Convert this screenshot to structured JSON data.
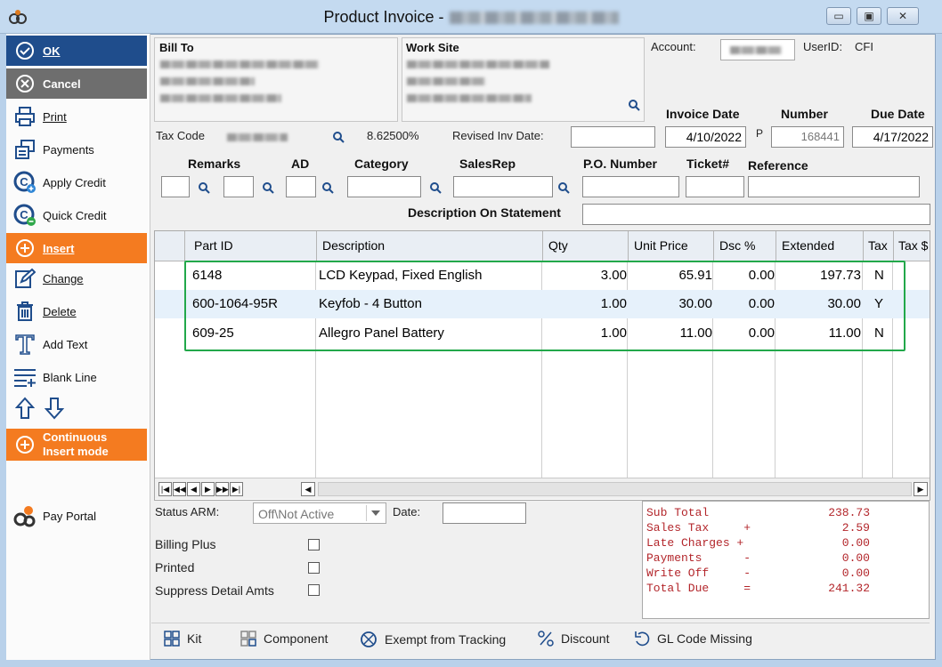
{
  "window": {
    "title": "Product Invoice -",
    "minimize_glyph": "▭",
    "maximize_glyph": "▣",
    "close_glyph": "✕"
  },
  "sidebar": {
    "ok": "OK",
    "cancel": "Cancel",
    "print": "Print",
    "payments": "Payments",
    "apply_credit": "Apply Credit",
    "quick_credit": "Quick Credit",
    "insert": "Insert",
    "change": "Change",
    "delete": "Delete",
    "add_text": "Add Text",
    "blank_line": "Blank Line",
    "continuous_line1": "Continuous",
    "continuous_line2": "Insert mode",
    "pay_portal": "Pay Portal"
  },
  "header": {
    "bill_to_label": "Bill To",
    "work_site_label": "Work Site",
    "account_label": "Account:",
    "user_id_label": "UserID:",
    "user_id_value": "CFI",
    "tax_code_label": "Tax Code",
    "tax_rate": "8.62500%",
    "revised_inv_date_label": "Revised Inv Date:",
    "invoice_date_label": "Invoice Date",
    "invoice_date_value": "4/10/2022",
    "number_label": "Number",
    "number_prefix": "P",
    "number_value": "168441",
    "due_date_label": "Due Date",
    "due_date_value": "4/17/2022",
    "remarks_label": "Remarks",
    "ad_label": "AD",
    "category_label": "Category",
    "salesrep_label": "SalesRep",
    "po_number_label": "P.O. Number",
    "ticket_label": "Ticket#",
    "reference_label": "Reference",
    "desc_on_statement_label": "Description On Statement"
  },
  "grid": {
    "columns": [
      "Part ID",
      "Description",
      "Qty",
      "Unit Price",
      "Dsc %",
      "Extended",
      "Tax",
      "Tax $"
    ],
    "rows": [
      {
        "part_id": "6148",
        "description": "LCD Keypad, Fixed English",
        "qty": "3.00",
        "unit_price": "65.91",
        "dsc": "0.00",
        "extended": "197.73",
        "tax": "N"
      },
      {
        "part_id": "600-1064-95R",
        "description": "Keyfob - 4 Button",
        "qty": "1.00",
        "unit_price": "30.00",
        "dsc": "0.00",
        "extended": "30.00",
        "tax": "Y"
      },
      {
        "part_id": "609-25",
        "description": "Allegro Panel Battery",
        "qty": "1.00",
        "unit_price": "11.00",
        "dsc": "0.00",
        "extended": "11.00",
        "tax": "N"
      }
    ],
    "nav": {
      "first": "|◀",
      "prev_page": "◀◀",
      "prev": "◀",
      "next": "▶",
      "next_page": "▶▶",
      "last": "▶|",
      "scroll_left": "◀",
      "scroll_right": "▶"
    }
  },
  "footer": {
    "status_arm_label": "Status ARM:",
    "status_arm_value": "Off\\Not Active",
    "date_label": "Date:",
    "billing_plus_label": "Billing Plus",
    "printed_label": "Printed",
    "suppress_detail_label": "Suppress Detail Amts"
  },
  "totals": {
    "lines": [
      {
        "label": "Sub Total      ",
        "value": "238.73"
      },
      {
        "label": "Sales Tax     +",
        "value": "2.59"
      },
      {
        "label": "Late Charges +",
        "value": "0.00"
      },
      {
        "label": "Payments      -",
        "value": "0.00"
      },
      {
        "label": "Write Off     -",
        "value": "0.00"
      },
      {
        "label": "Total Due     =",
        "value": "241.32"
      }
    ]
  },
  "bottom_bar": {
    "kit": "Kit",
    "component": "Component",
    "exempt": "Exempt from Tracking",
    "discount": "Discount",
    "gl_code": "GL Code Missing"
  },
  "colors": {
    "accent_blue": "#1f4d8c",
    "accent_orange": "#f47b20",
    "highlight_green": "#22a84a",
    "totals_red": "#b3262b"
  }
}
